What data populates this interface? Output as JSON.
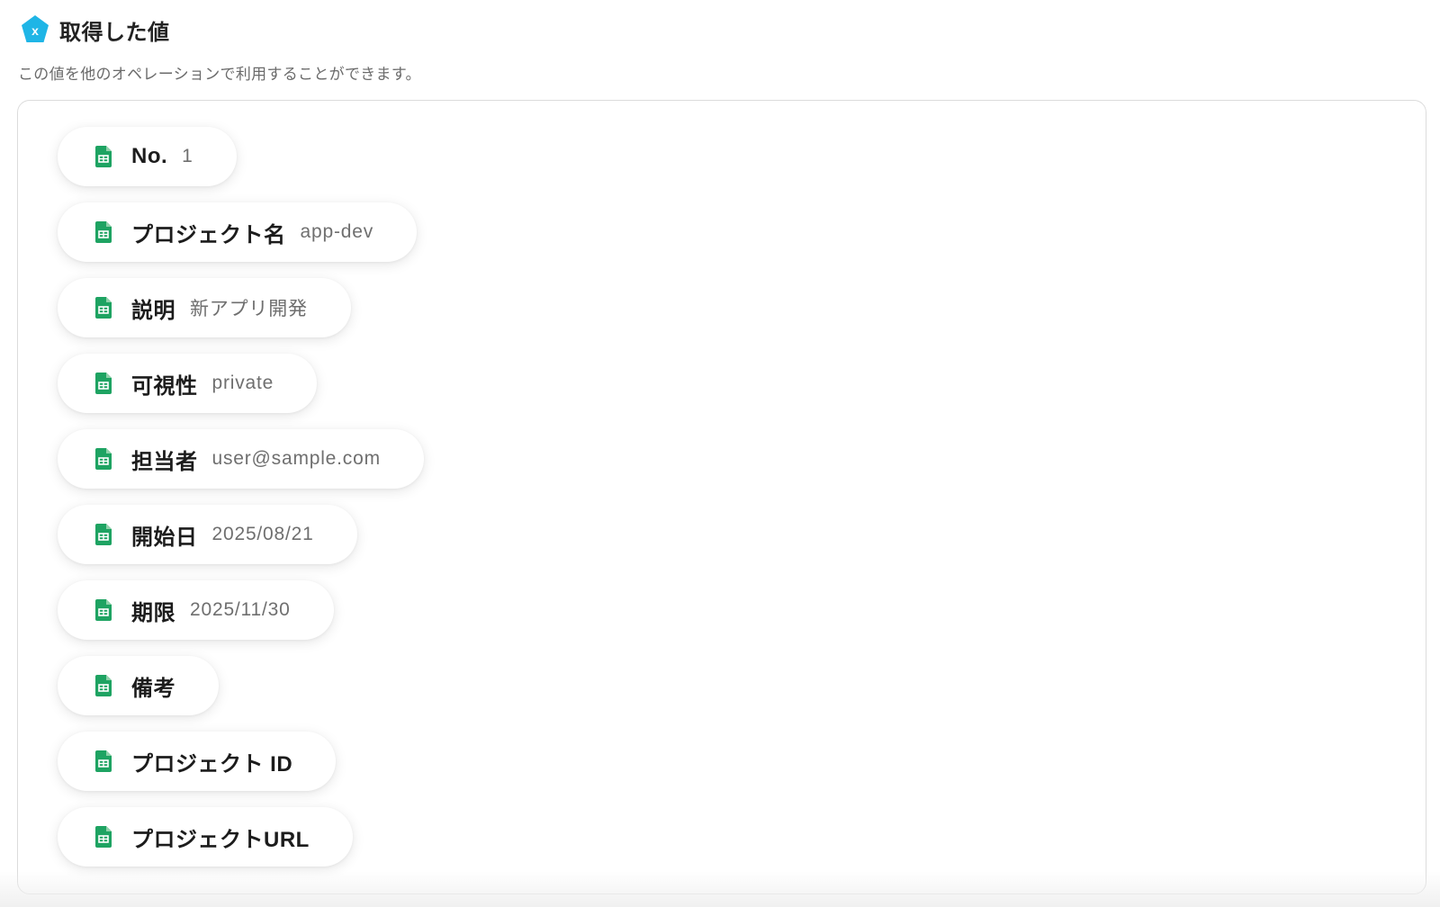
{
  "header": {
    "title": "取得した値",
    "icon": "variable-x-icon",
    "accent_color": "#1fb5e6"
  },
  "subtitle": "この値を他のオペレーションで利用することができます。",
  "items": [
    {
      "label": "No.",
      "value": "1"
    },
    {
      "label": "プロジェクト名",
      "value": "app-dev"
    },
    {
      "label": "説明",
      "value": "新アプリ開発"
    },
    {
      "label": "可視性",
      "value": "private"
    },
    {
      "label": "担当者",
      "value": "user@sample.com"
    },
    {
      "label": "開始日",
      "value": "2025/08/21"
    },
    {
      "label": "期限",
      "value": "2025/11/30"
    },
    {
      "label": "備考",
      "value": ""
    },
    {
      "label": "プロジェクト ID",
      "value": ""
    },
    {
      "label": "プロジェクトURL",
      "value": ""
    }
  ],
  "item_icon": "google-sheets-icon",
  "sheets_color": "#1ea362"
}
